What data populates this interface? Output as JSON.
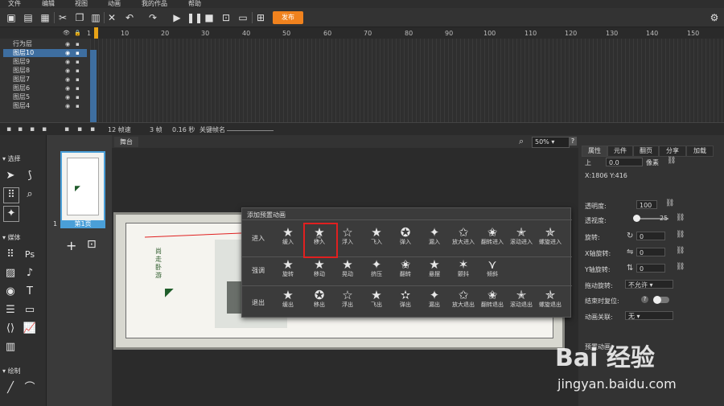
{
  "menu": [
    "文件",
    "编辑",
    "视图",
    "动画",
    "我的作品",
    "帮助"
  ],
  "toolbar": {
    "publish_label": "发布"
  },
  "timeline": {
    "ruler_ticks": [
      "1",
      "10",
      "20",
      "30",
      "40",
      "50",
      "60",
      "70",
      "80",
      "90",
      "100",
      "110",
      "120",
      "130",
      "140",
      "150"
    ],
    "layers": [
      "行为层",
      "图层10",
      "图层9",
      "图层8",
      "图层7",
      "图层6",
      "图层5",
      "图层4"
    ],
    "footer": {
      "fps": "12 帧速",
      "frames": "3 帧",
      "seconds": "0.16 秒",
      "keyframe_label": "关键帧名"
    }
  },
  "tools": {
    "select_section": "选择",
    "media_section": "媒体",
    "draw_section": "绘制"
  },
  "pages": {
    "page_number": "1",
    "page_label": "第1页"
  },
  "stage": {
    "tab": "舞台",
    "zoom": "50%"
  },
  "canvas": {
    "vertical_text": "尚走卧游"
  },
  "popup": {
    "title": "添加预置动画",
    "groups": [
      {
        "label": "进入",
        "items": [
          "缓入",
          "移入",
          "浮入",
          "飞入",
          "弹入",
          "漏入",
          "放大进入",
          "翻转进入",
          "滚动进入",
          "螺旋进入"
        ]
      },
      {
        "label": "强调",
        "items": [
          "旋转",
          "移动",
          "晃动",
          "挤压",
          "翻转",
          "悬摆",
          "颤抖",
          "倾斜"
        ]
      },
      {
        "label": "退出",
        "items": [
          "缓出",
          "移出",
          "浮出",
          "飞出",
          "弹出",
          "漏出",
          "放大退出",
          "翻转退出",
          "滚动退出",
          "螺旋退出"
        ]
      }
    ]
  },
  "props": {
    "tabs": [
      "属性",
      "元件",
      "翻页",
      "分享",
      "加载"
    ],
    "top_label": "上",
    "top_value": "0.0",
    "unit": "像素",
    "coords": "X:1806  Y:416",
    "opacity_label": "透明度:",
    "opacity_value": "100",
    "viewport_label": "透视度:",
    "viewport_value": "25",
    "rotate_label": "旋转:",
    "rotate_value": "0",
    "x_rotate_label": "X轴旋转:",
    "x_rotate_value": "0",
    "y_rotate_label": "Y轴旋转:",
    "y_rotate_value": "0",
    "drag_rotate_label": "拖动旋转:",
    "drag_rotate_value": "不允许",
    "end_reset_label": "结束时复位:",
    "anim_link_label": "动画关联:",
    "anim_link_value": "无",
    "preview_label": "预置动画"
  },
  "watermark": {
    "brand": "Bai 经验",
    "url": "jingyan.baidu.com"
  }
}
